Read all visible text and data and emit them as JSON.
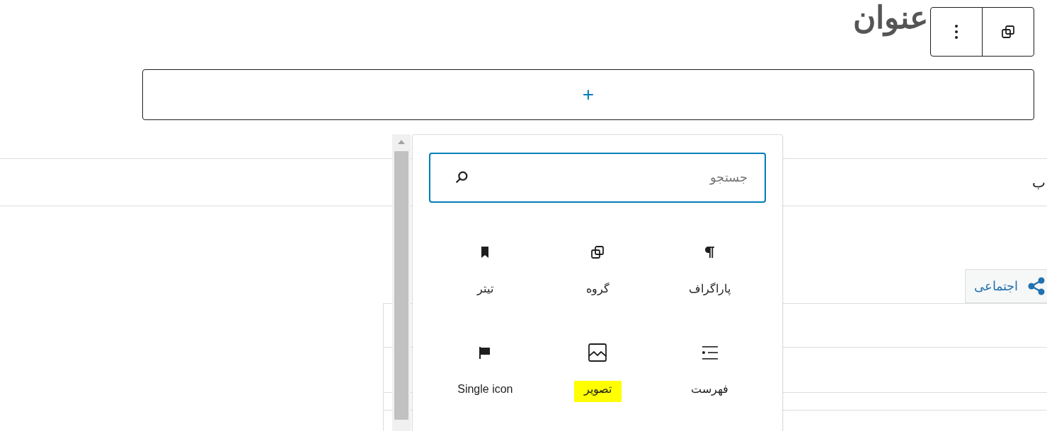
{
  "title": "عنوان",
  "appender": {
    "symbol": "+"
  },
  "tab_bar": {
    "label": "ب"
  },
  "social_tab": {
    "label": "اجتماعی"
  },
  "inserter": {
    "search": {
      "placeholder": "جستجو"
    },
    "blocks": [
      {
        "label": "پاراگراف",
        "highlighted": false
      },
      {
        "label": "گروه",
        "highlighted": false
      },
      {
        "label": "تیتر",
        "highlighted": false
      },
      {
        "label": "فهرست",
        "highlighted": false
      },
      {
        "label": "تصویر",
        "highlighted": true
      },
      {
        "label": "Single icon",
        "highlighted": false
      }
    ]
  }
}
